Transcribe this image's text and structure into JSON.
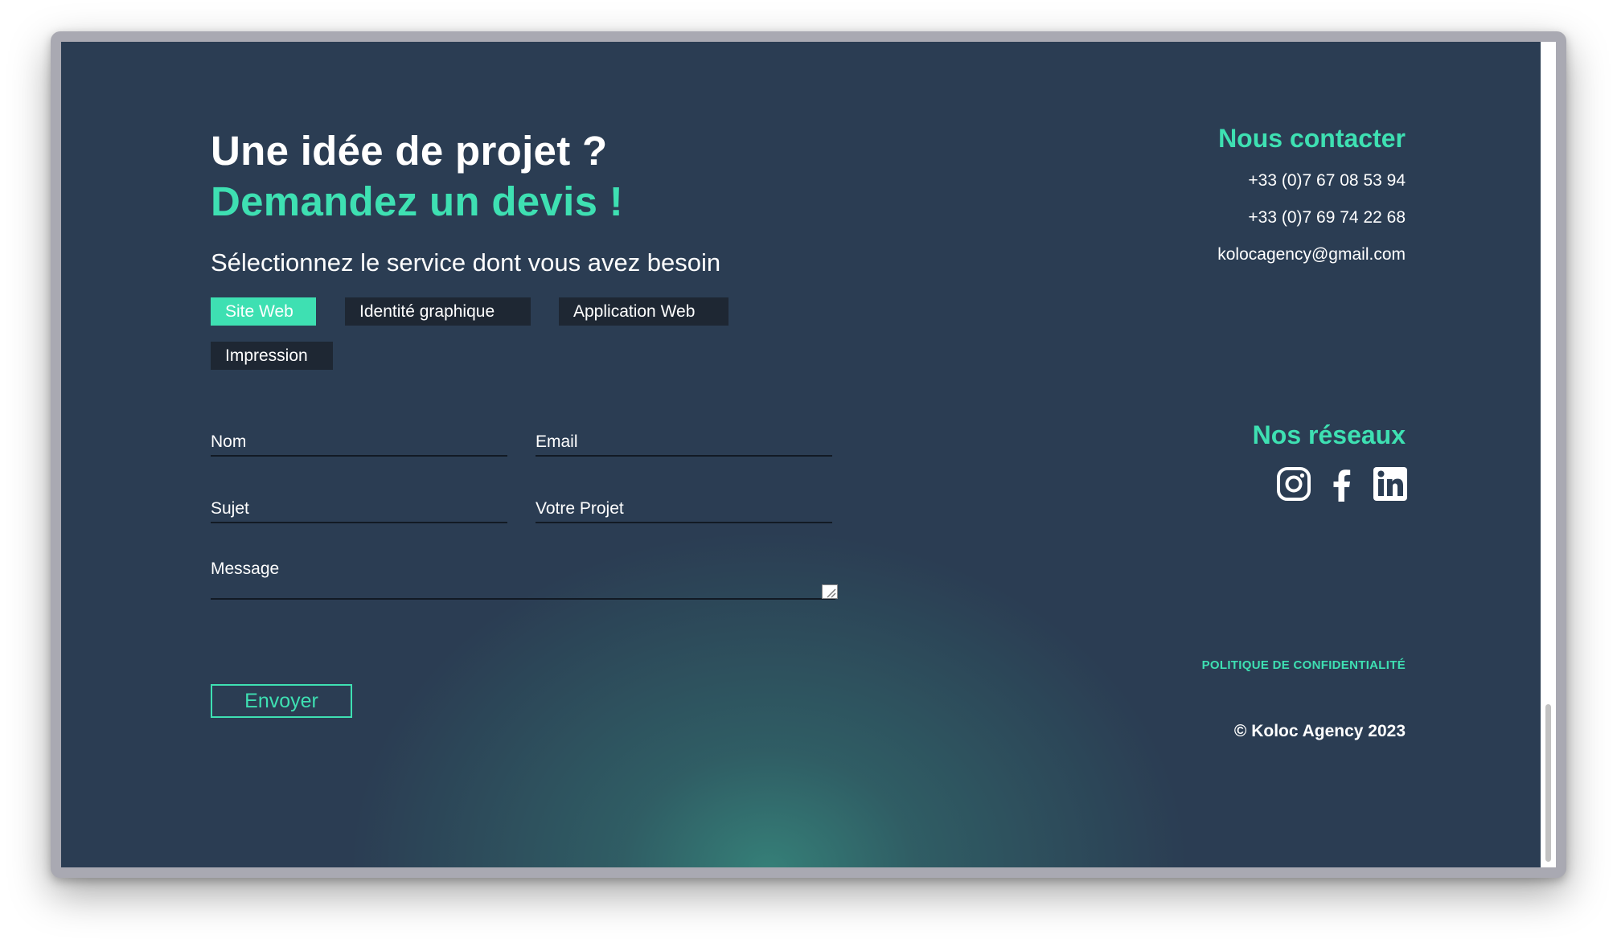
{
  "hero": {
    "title_line1": "Une idée de projet ?",
    "title_line2": "Demandez un devis !",
    "service_prompt": "Sélectionnez le service dont vous avez besoin"
  },
  "services": [
    {
      "label": "Site Web",
      "selected": true
    },
    {
      "label": "Identité graphique",
      "selected": false
    },
    {
      "label": "Application Web",
      "selected": false
    },
    {
      "label": "Impression",
      "selected": false
    }
  ],
  "form": {
    "name_label": "Nom",
    "email_label": "Email",
    "subject_label": "Sujet",
    "project_label": "Votre Projet",
    "message_label": "Message",
    "submit_label": "Envoyer"
  },
  "contact": {
    "heading": "Nous contacter",
    "phone1": "+33 (0)7 67 08 53 94",
    "phone2": "+33 (0)7 69 74 22 68",
    "email": "kolocagency@gmail.com"
  },
  "networks": {
    "heading": "Nos réseaux",
    "icons": [
      "instagram-icon",
      "facebook-icon",
      "linkedin-icon"
    ]
  },
  "footer": {
    "privacy": "POLITIQUE DE CONFIDENTIALITÉ",
    "copyright": "© Koloc Agency 2023"
  },
  "colors": {
    "background": "#2b3d53",
    "accent": "#3ee0b2",
    "chip": "#1e2733"
  }
}
